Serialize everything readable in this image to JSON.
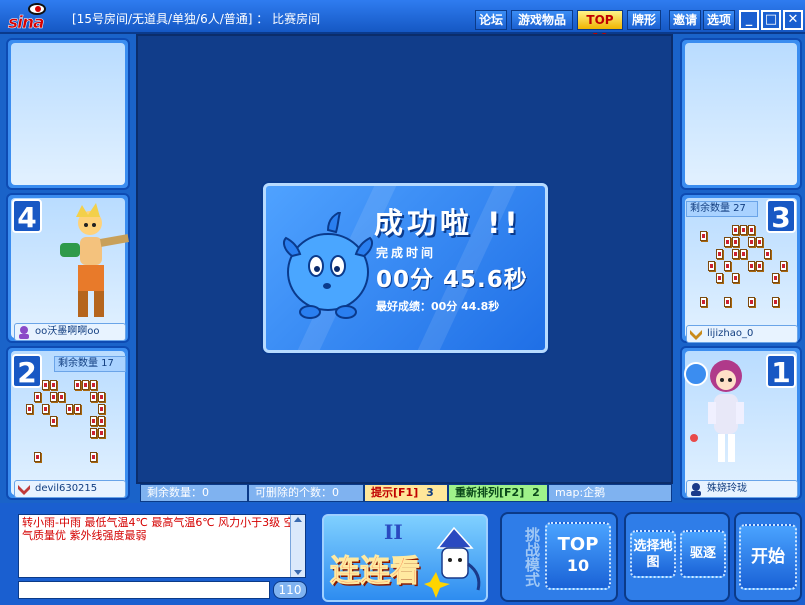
{
  "title_bar": {
    "logo_text": "sina",
    "room_title": "[15号房间/无道具/单独/6人/普通] ： 比赛房间",
    "nav_buttons": [
      {
        "label": "论坛",
        "active": false
      },
      {
        "label": "游戏物品",
        "active": false
      },
      {
        "label": "TOP 10",
        "active": true
      },
      {
        "label": "牌形",
        "active": false
      },
      {
        "label": "邀请",
        "active": false
      },
      {
        "label": "选项",
        "active": false
      }
    ],
    "window_buttons": {
      "minimize": "_",
      "maximize": "□",
      "close": "✕"
    }
  },
  "seats": {
    "seat4": {
      "number": "4",
      "player": "oo沃墨啊啊oo",
      "rank_icon": "person-icon"
    },
    "seat3": {
      "number": "3",
      "remaining_label": "剩余数量 27",
      "player": "lijizhao_0",
      "rank_icon": "chevron-badge-icon"
    },
    "seat2": {
      "number": "2",
      "remaining_label": "剩余数量 17",
      "player": "devil630215",
      "rank_icon": "chevron-badge-icon"
    },
    "seat1": {
      "number": "1",
      "player": "姝娆玲珑",
      "rank_icon": "person-icon"
    }
  },
  "result_dialog": {
    "title": "成功啦 !!",
    "time_label": "完成时间",
    "time_value": "00分 45.6秒",
    "best_label": "最好成绩：00分 44.8秒"
  },
  "status_bar": {
    "remaining": "剩余数量：0",
    "removable": "可删除的个数：0",
    "hint_key": "提示[F1]",
    "hint_count": "3",
    "reshuffle_key": "重新排列[F2]",
    "reshuffle_count": "2",
    "map": "map:企鹅"
  },
  "chat": {
    "message": "转小雨-中雨 最低气温4℃ 最高气温6℃ 风力小于3级 空气质量优 紫外线强度最弱",
    "input_value": "",
    "char_count": "110"
  },
  "game_logo": {
    "text": "连连看",
    "version": "II"
  },
  "controls": {
    "challenge_mode": "挑战模式",
    "top10_line1": "TOP",
    "top10_line2": "10",
    "select_map": "选择地图",
    "kick": "驱逐",
    "start": "开始"
  },
  "colors": {
    "accent": "#1a63c9",
    "board_bg": "#113d8a",
    "warning_red": "#d40000"
  }
}
